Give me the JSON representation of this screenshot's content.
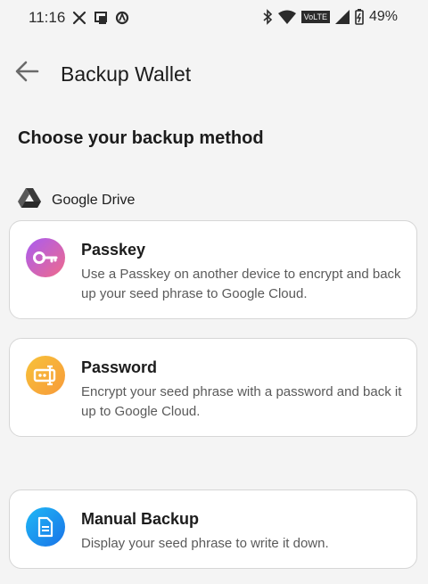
{
  "status_bar": {
    "time": "11:16",
    "battery": "49%",
    "icons_left": [
      "x-icon",
      "cast-icon",
      "data-saver-icon"
    ],
    "icons_right": [
      "bluetooth-icon",
      "wifi-icon",
      "volte-icon",
      "signal-icon",
      "battery-icon"
    ],
    "volte_label": "VoLTE"
  },
  "header": {
    "title": "Backup Wallet"
  },
  "section": {
    "title": "Choose your backup method",
    "provider_label": "Google Drive"
  },
  "options": [
    {
      "title": "Passkey",
      "description": "Use a Passkey on another device to encrypt and back up your seed phrase to Google Cloud.",
      "icon": "key-icon",
      "colors": [
        "#a85cf2",
        "#f06a8a"
      ]
    },
    {
      "title": "Password",
      "description": "Encrypt your seed phrase with a password and back it up to Google Cloud.",
      "icon": "password-input-icon",
      "colors": [
        "#f7c23a",
        "#f79a3a"
      ]
    },
    {
      "title": "Manual Backup",
      "description": "Display your seed phrase to write it down.",
      "icon": "document-icon",
      "colors": [
        "#1fb8f5",
        "#1a73e8"
      ]
    }
  ]
}
